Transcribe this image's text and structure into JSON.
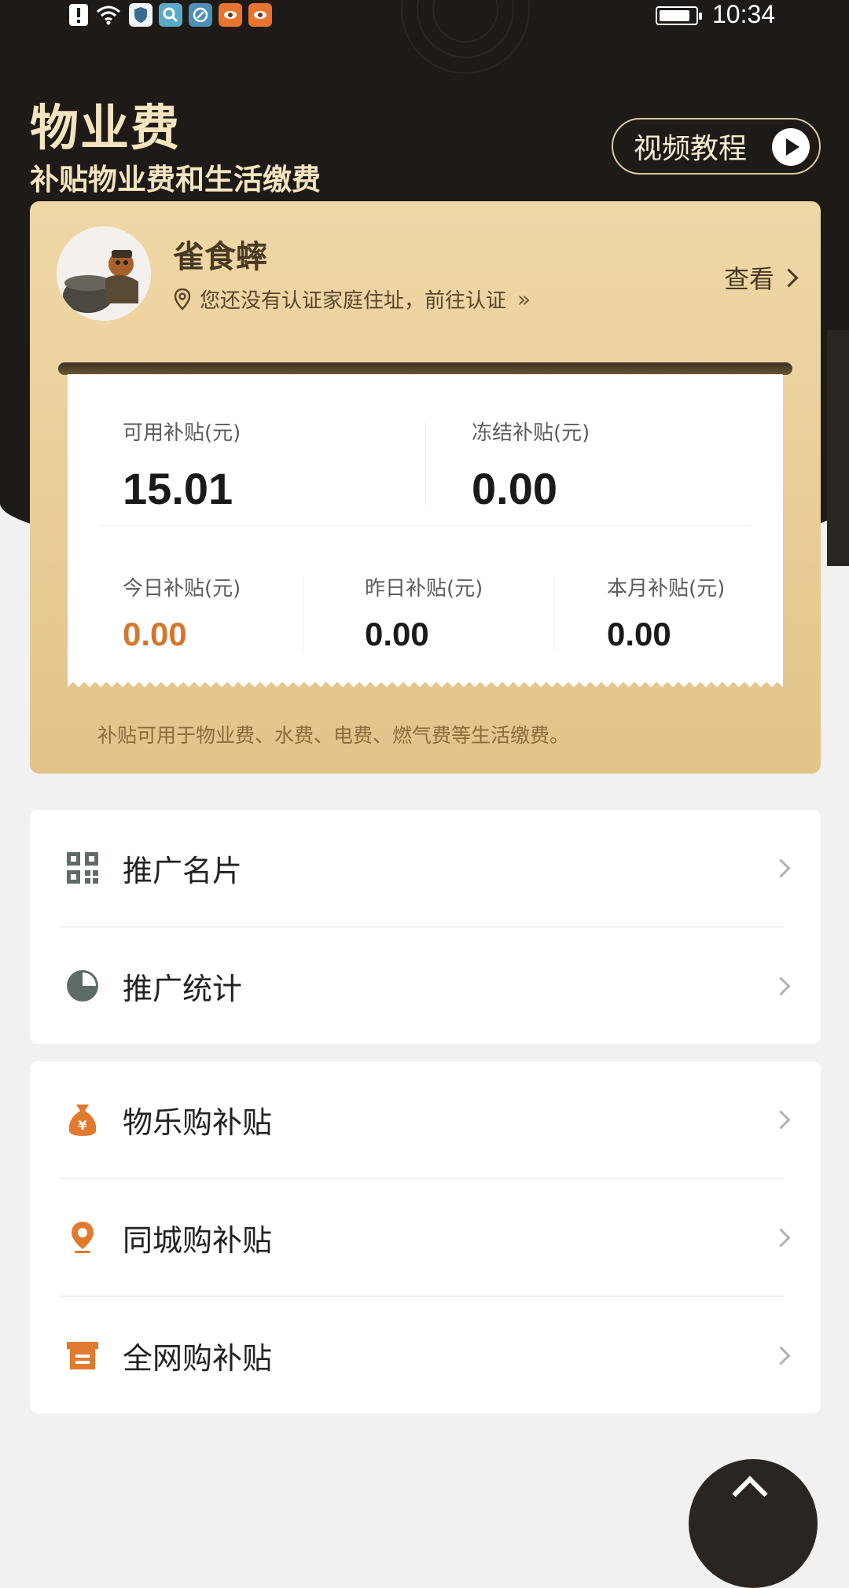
{
  "status_bar": {
    "icons": [
      "alert-icon",
      "wifi-icon",
      "shield-icon",
      "search-app-icon",
      "browser-app-icon",
      "app-eye-icon",
      "app-eye-icon"
    ],
    "time": "10:34"
  },
  "header": {
    "title": "物业费",
    "subtitle": "补贴物业费和生活缴费",
    "video_button": "视频教程"
  },
  "profile": {
    "name": "雀食蟀",
    "address_prompt": "您还没有认证家庭住址，前往认证",
    "view_label": "查看"
  },
  "stats": {
    "available_label": "可用补贴(元)",
    "available_value": "15.01",
    "frozen_label": "冻结补贴(元)",
    "frozen_value": "0.00",
    "today_label": "今日补贴(元)",
    "today_value": "0.00",
    "yesterday_label": "昨日补贴(元)",
    "yesterday_value": "0.00",
    "month_label": "本月补贴(元)",
    "month_value": "0.00"
  },
  "card_note": "补贴可用于物业费、水费、电费、燃气费等生活缴费。",
  "menu_group1": [
    {
      "label": "推广名片",
      "icon": "qr-code-icon"
    },
    {
      "label": "推广统计",
      "icon": "pie-chart-icon"
    }
  ],
  "menu_group2": [
    {
      "label": "物乐购补贴",
      "icon": "money-bag-icon"
    },
    {
      "label": "同城购补贴",
      "icon": "location-pin-icon"
    },
    {
      "label": "全网购补贴",
      "icon": "shop-icon"
    }
  ],
  "colors": {
    "header_bg": "#1e1a17",
    "gold": "#e8c990",
    "accent": "#d4762c",
    "icon_gray": "#5f6b68"
  }
}
